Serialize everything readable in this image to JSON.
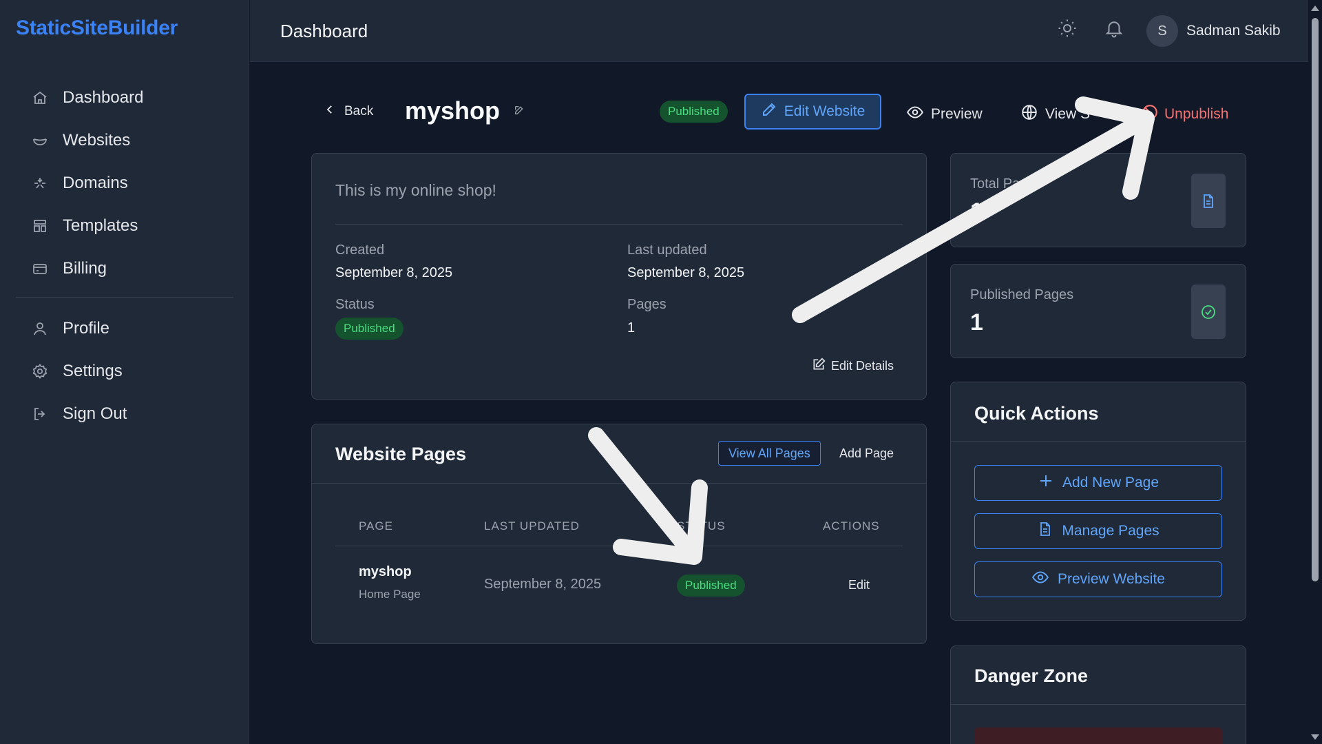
{
  "app": {
    "brand": "StaticSiteBuilder"
  },
  "sidebar": {
    "items": [
      {
        "label": "Dashboard",
        "icon": "home-icon"
      },
      {
        "label": "Websites",
        "icon": "bowl-icon"
      },
      {
        "label": "Domains",
        "icon": "sparkle-icon"
      },
      {
        "label": "Templates",
        "icon": "layout-icon"
      },
      {
        "label": "Billing",
        "icon": "credit-card-icon"
      }
    ],
    "secondary": [
      {
        "label": "Profile",
        "icon": "user-icon"
      },
      {
        "label": "Settings",
        "icon": "gear-icon"
      },
      {
        "label": "Sign Out",
        "icon": "sign-out-icon"
      }
    ]
  },
  "header": {
    "title": "Dashboard",
    "user": {
      "initial": "S",
      "name": "Sadman Sakib"
    }
  },
  "site": {
    "back_label": "Back",
    "name": "myshop",
    "status": "Published",
    "actions": {
      "edit": "Edit Website",
      "preview": "Preview",
      "view": "View S",
      "unpublish": "Unpublish"
    },
    "description": "This is my online shop!",
    "fields": {
      "created_label": "Created",
      "created_value": "September 8, 2025",
      "updated_label": "Last updated",
      "updated_value": "September 8, 2025",
      "status_label": "Status",
      "status_value": "Published",
      "pages_label": "Pages",
      "pages_value": "1"
    },
    "edit_details": "Edit Details"
  },
  "pages_panel": {
    "title": "Website Pages",
    "view_all": "View All Pages",
    "add_page": "Add Page",
    "columns": [
      "PAGE",
      "LAST UPDATED",
      "STATUS",
      "ACTIONS"
    ],
    "rows": [
      {
        "name": "myshop",
        "subtitle": "Home Page",
        "updated": "September 8, 2025",
        "status": "Published",
        "action": "Edit"
      }
    ]
  },
  "stats": {
    "total_label": "Total Pages",
    "total_value": "1",
    "published_label": "Published Pages",
    "published_value": "1"
  },
  "quick_actions": {
    "title": "Quick Actions",
    "buttons": [
      "Add New Page",
      "Manage Pages",
      "Preview Website"
    ]
  },
  "danger_zone": {
    "title": "Danger Zone"
  },
  "colors": {
    "accent": "#3b82f6",
    "success": "#4ade80",
    "danger": "#f87171",
    "background": "#111827",
    "surface": "#1f2937"
  }
}
